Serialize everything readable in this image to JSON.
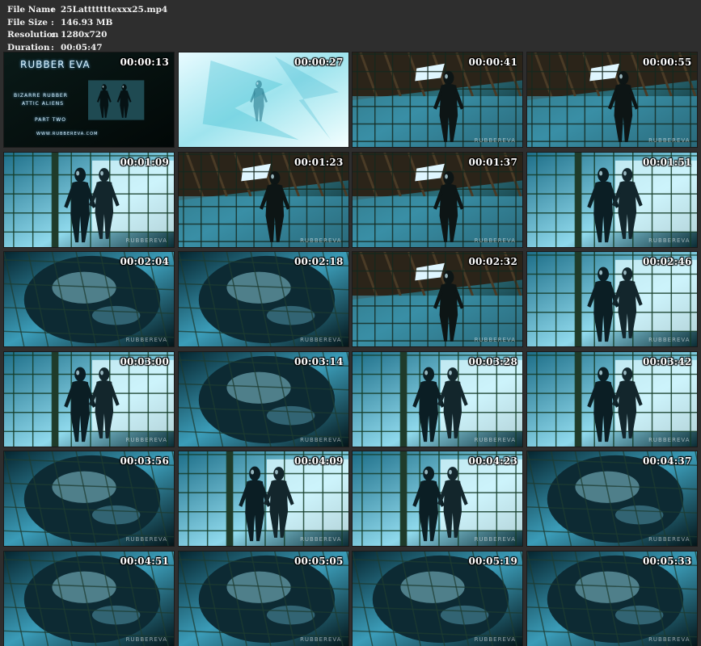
{
  "file_info": {
    "file_name_label": "File Name",
    "file_name_value": "25Latttttttexxx25.mp4",
    "file_size_label": "File Size",
    "file_size_value": "146.93 MB",
    "resolution_label": "Resolution",
    "resolution_value": "1280x720",
    "duration_label": "Duration",
    "duration_value": "00:05:47",
    "separator": ":"
  },
  "title_card": {
    "brand": "RUBBER EVA",
    "line1": "BIZARRE RUBBER",
    "line2": "ATTIC ALIENS",
    "line3": "PART TWO",
    "site": "WWW.RUBBEREVA.COM"
  },
  "watermark": "RUBBEREVA",
  "thumbnails": [
    {
      "timestamp": "00:00:13",
      "scene": "title"
    },
    {
      "timestamp": "00:00:27",
      "scene": "flash"
    },
    {
      "timestamp": "00:00:41",
      "scene": "attic"
    },
    {
      "timestamp": "00:00:55",
      "scene": "attic"
    },
    {
      "timestamp": "00:01:09",
      "scene": "cage"
    },
    {
      "timestamp": "00:01:23",
      "scene": "attic"
    },
    {
      "timestamp": "00:01:37",
      "scene": "attic"
    },
    {
      "timestamp": "00:01:51",
      "scene": "cage"
    },
    {
      "timestamp": "00:02:04",
      "scene": "closeup"
    },
    {
      "timestamp": "00:02:18",
      "scene": "closeup"
    },
    {
      "timestamp": "00:02:32",
      "scene": "attic"
    },
    {
      "timestamp": "00:02:46",
      "scene": "cage"
    },
    {
      "timestamp": "00:03:00",
      "scene": "cage"
    },
    {
      "timestamp": "00:03:14",
      "scene": "closeup"
    },
    {
      "timestamp": "00:03:28",
      "scene": "cage"
    },
    {
      "timestamp": "00:03:42",
      "scene": "cage"
    },
    {
      "timestamp": "00:03:56",
      "scene": "closeup"
    },
    {
      "timestamp": "00:04:09",
      "scene": "cage"
    },
    {
      "timestamp": "00:04:23",
      "scene": "cage"
    },
    {
      "timestamp": "00:04:37",
      "scene": "closeup"
    },
    {
      "timestamp": "00:04:51",
      "scene": "closeup"
    },
    {
      "timestamp": "00:05:05",
      "scene": "closeup"
    },
    {
      "timestamp": "00:05:19",
      "scene": "closeup"
    },
    {
      "timestamp": "00:05:33",
      "scene": "closeup"
    }
  ]
}
